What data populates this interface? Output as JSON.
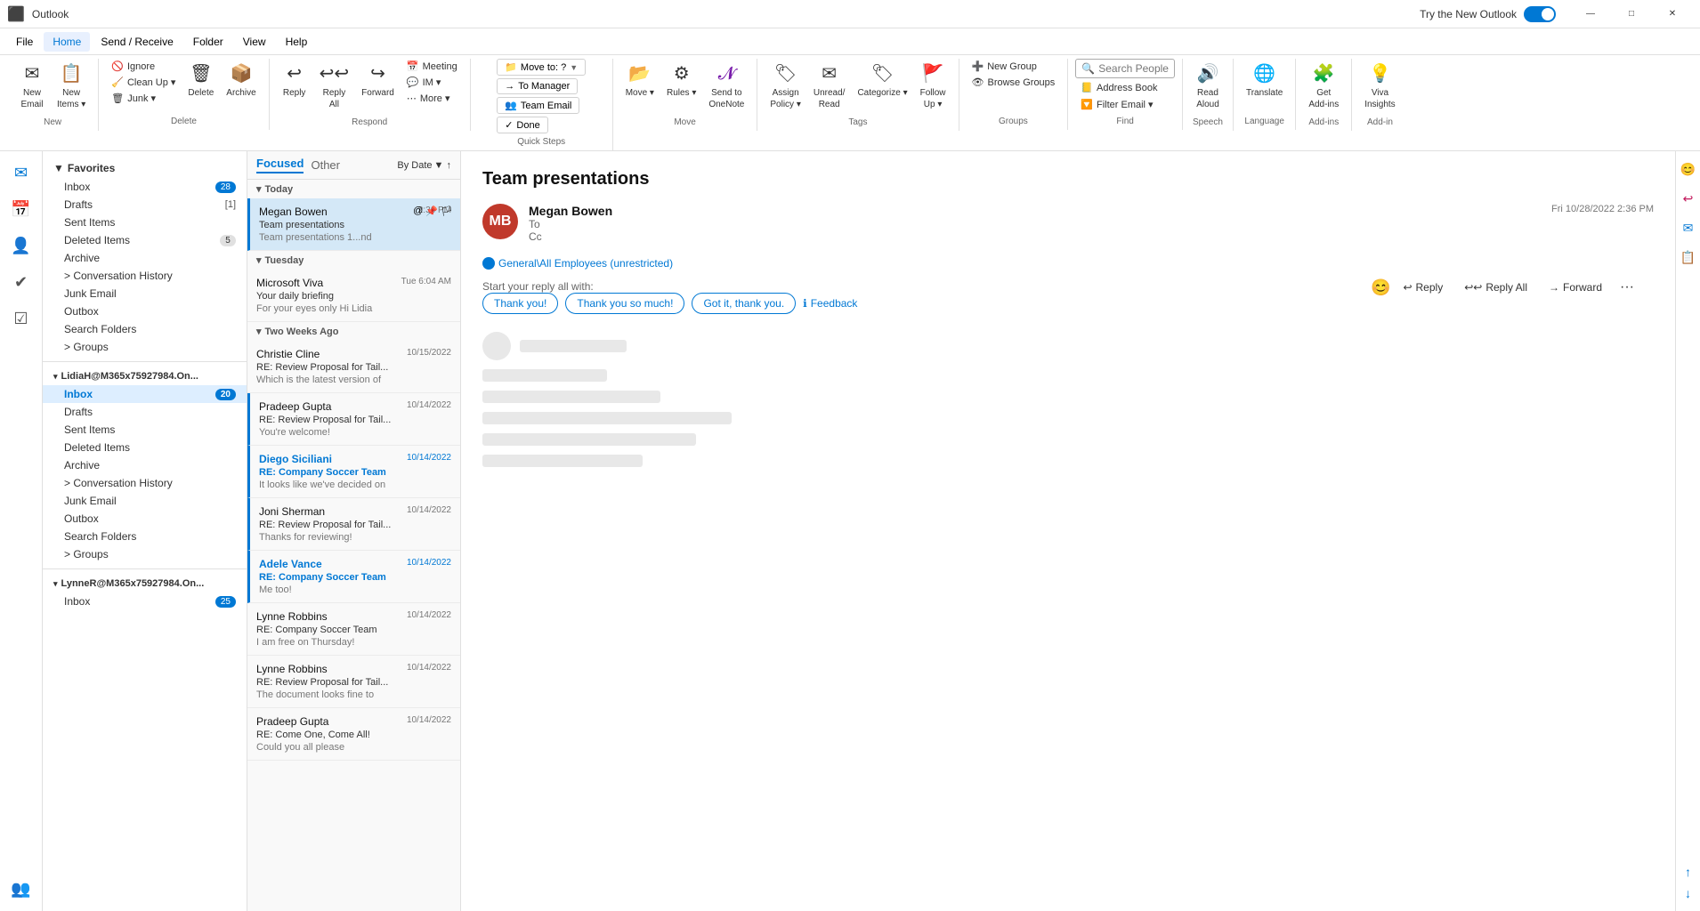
{
  "titleBar": {
    "appName": "Outlook",
    "tryNewOutlook": "Try the New Outlook",
    "windowControls": [
      "—",
      "□",
      "✕"
    ]
  },
  "menuBar": {
    "items": [
      "File",
      "Home",
      "Send / Receive",
      "Folder",
      "View",
      "Help"
    ]
  },
  "ribbon": {
    "groups": {
      "new": {
        "label": "New",
        "newEmail": "New\nEmail",
        "newItems": "New\nItems"
      },
      "delete": {
        "label": "Delete",
        "ignore": "Ignore",
        "cleanUp": "Clean Up",
        "junk": "Junk",
        "delete": "Delete",
        "archive": "Archive"
      },
      "respond": {
        "label": "Respond",
        "reply": "Reply",
        "replyAll": "Reply\nAll",
        "forward": "Forward",
        "meeting": "Meeting",
        "im": "IM →",
        "more": "More →"
      },
      "quickSteps": {
        "label": "Quick Steps",
        "moveTo": "Move to: ?",
        "toManager": "→ To Manager",
        "teamEmail": "Team Email",
        "done": "✓ Done",
        "arrow": "▼",
        "launcher": "↗"
      },
      "move": {
        "label": "Move",
        "move": "Move",
        "rules": "Rules",
        "sendToOneNote": "Send to\nOneNote"
      },
      "tags": {
        "label": "Tags",
        "assignPolicy": "Assign\nPolicy",
        "unreadRead": "Unread/\nRead",
        "categorize": "Categorize",
        "followUp": "Follow\nUp"
      },
      "groups": {
        "label": "Groups",
        "newGroup": "New Group",
        "browseGroups": "Browse Groups"
      },
      "find": {
        "label": "Find",
        "searchPeople": "Search People",
        "addressBook": "Address Book",
        "filterEmail": "Filter Email"
      },
      "speech": {
        "label": "Speech",
        "readAloud": "Read\nAloud"
      },
      "language": {
        "label": "Language",
        "translate": "Translate"
      },
      "addins": {
        "label": "Add-ins",
        "getAddins": "Get\nAdd-ins"
      },
      "addin": {
        "label": "Add-in",
        "vivaInsights": "Viva\nInsights"
      }
    }
  },
  "sidebar": {
    "favorites": {
      "label": "Favorites",
      "items": [
        {
          "name": "Inbox",
          "badge": "28"
        },
        {
          "name": "Drafts",
          "badge": "[1]"
        },
        {
          "name": "Sent Items",
          "badge": ""
        },
        {
          "name": "Deleted Items",
          "badge": "5"
        },
        {
          "name": "Archive",
          "badge": ""
        },
        {
          "name": "Conversation History",
          "badge": ""
        },
        {
          "name": "Junk Email",
          "badge": ""
        },
        {
          "name": "Outbox",
          "badge": ""
        },
        {
          "name": "Search Folders",
          "badge": ""
        },
        {
          "name": "Groups",
          "badge": ""
        }
      ]
    },
    "account1": {
      "name": "LidiaH@M365x75927984.On...",
      "items": [
        {
          "name": "Inbox",
          "badge": "20",
          "active": true
        },
        {
          "name": "Drafts",
          "badge": ""
        },
        {
          "name": "Sent Items",
          "badge": ""
        },
        {
          "name": "Deleted Items",
          "badge": ""
        },
        {
          "name": "Archive",
          "badge": ""
        },
        {
          "name": "Conversation History",
          "badge": ""
        },
        {
          "name": "Junk Email",
          "badge": ""
        },
        {
          "name": "Outbox",
          "badge": ""
        },
        {
          "name": "Search Folders",
          "badge": ""
        },
        {
          "name": "Groups",
          "badge": ""
        }
      ]
    },
    "account2": {
      "name": "LynneR@M365x75927984.On...",
      "items": [
        {
          "name": "Inbox",
          "badge": "25"
        }
      ]
    }
  },
  "emailList": {
    "tabs": {
      "focused": "Focused",
      "other": "Other"
    },
    "sortLabel": "By Date",
    "sortDir": "↑",
    "dateGroups": [
      {
        "label": "Today",
        "emails": [
          {
            "sender": "Megan Bowen",
            "subject": "Team presentations",
            "preview": "Team presentations 1..nd",
            "date": "2:36 PM",
            "selected": true,
            "unread": true,
            "icons": [
              "@",
              "📌"
            ]
          }
        ]
      },
      {
        "label": "Tuesday",
        "emails": [
          {
            "sender": "Microsoft Viva",
            "subject": "Your daily briefing",
            "preview": "For your eyes only  Hi Lidia",
            "date": "Tue 6:04 AM",
            "selected": false,
            "unread": false,
            "icons": []
          }
        ]
      },
      {
        "label": "Two Weeks Ago",
        "emails": [
          {
            "sender": "Christie Cline",
            "subject": "RE: Review Proposal for Tail...",
            "preview": "Which is the latest version of",
            "date": "10/15/2022",
            "selected": false,
            "unread": false,
            "icons": [],
            "blueAccent": false
          },
          {
            "sender": "Pradeep Gupta",
            "subject": "RE: Review Proposal for Tail...",
            "preview": "You're welcome!",
            "date": "10/14/2022",
            "selected": false,
            "unread": false,
            "icons": [],
            "blueAccent": true
          },
          {
            "sender": "Diego Siciliani",
            "subject": "RE: Company Soccer Team",
            "preview": "It looks like we've decided on",
            "date": "10/14/2022",
            "selected": false,
            "unread": true,
            "icons": [],
            "blueAccent": true
          },
          {
            "sender": "Joni Sherman",
            "subject": "RE: Review Proposal for Tail...",
            "preview": "Thanks for reviewing!",
            "date": "10/14/2022",
            "selected": false,
            "unread": false,
            "icons": [],
            "blueAccent": true
          },
          {
            "sender": "Adele Vance",
            "subject": "RE: Company Soccer Team",
            "preview": "Me too!",
            "date": "10/14/2022",
            "selected": false,
            "unread": true,
            "icons": [],
            "blueAccent": true
          },
          {
            "sender": "Lynne Robbins",
            "subject": "RE: Company Soccer Team",
            "preview": "I am free on Thursday!",
            "date": "10/14/2022",
            "selected": false,
            "unread": false,
            "icons": [],
            "blueAccent": false
          },
          {
            "sender": "Lynne Robbins",
            "subject": "RE: Review Proposal for Tail...",
            "preview": "The document looks fine to",
            "date": "10/14/2022",
            "selected": false,
            "unread": false,
            "icons": [],
            "blueAccent": false
          },
          {
            "sender": "Pradeep Gupta",
            "subject": "RE: Come One, Come All!",
            "preview": "Could you all please",
            "date": "10/14/2022",
            "selected": false,
            "unread": false,
            "icons": [],
            "blueAccent": false
          }
        ]
      }
    ]
  },
  "readingPane": {
    "title": "Team presentations",
    "senderName": "Megan Bowen",
    "senderInitials": "MB",
    "toLabel": "To",
    "ccLabel": "Cc",
    "date": "Fri 10/28/2022 2:36 PM",
    "generalBadge": "General\\All Employees (unrestricted)",
    "actions": {
      "emoji": "😊",
      "reply": "Reply",
      "replyAll": "Reply All",
      "forward": "Forward",
      "more": "..."
    },
    "quickReplies": {
      "label": "Start your reply all with:",
      "chips": [
        "Thank you!",
        "Thank you so much!",
        "Got it, thank you."
      ],
      "feedback": "Feedback"
    }
  },
  "rightBar": {
    "icons": [
      "😊",
      "↩",
      "✉",
      "📋",
      "↑",
      "↓"
    ]
  },
  "leftNav": {
    "icons": [
      {
        "name": "mail",
        "symbol": "✉",
        "active": true
      },
      {
        "name": "calendar",
        "symbol": "📅"
      },
      {
        "name": "contacts",
        "symbol": "👤"
      },
      {
        "name": "tasks",
        "symbol": "✔"
      },
      {
        "name": "to-do",
        "symbol": "☑"
      },
      {
        "name": "groups",
        "symbol": "👥"
      }
    ]
  }
}
